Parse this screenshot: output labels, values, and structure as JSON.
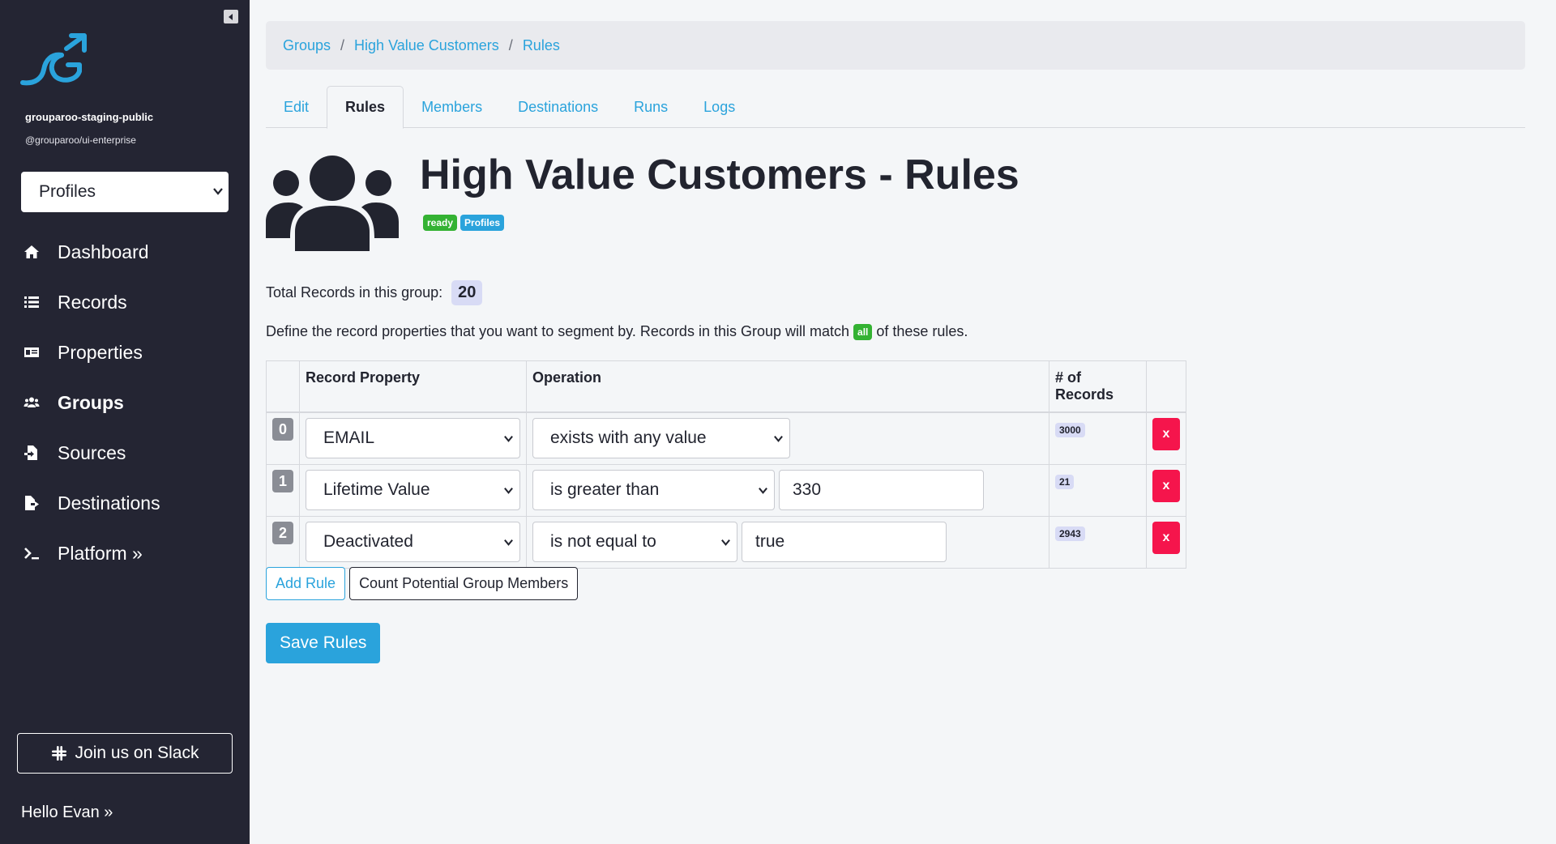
{
  "sidebar": {
    "org_name": "grouparoo-staging-public",
    "org_package": "@grouparoo/ui-enterprise",
    "model_select": "Profiles",
    "nav": [
      {
        "label": "Dashboard",
        "icon": "home-icon"
      },
      {
        "label": "Records",
        "icon": "list-icon"
      },
      {
        "label": "Properties",
        "icon": "id-card-icon"
      },
      {
        "label": "Groups",
        "icon": "users-icon",
        "active": true
      },
      {
        "label": "Sources",
        "icon": "file-import-icon"
      },
      {
        "label": "Destinations",
        "icon": "file-export-icon"
      },
      {
        "label": "Platform »",
        "icon": "terminal-icon"
      }
    ],
    "slack_label": "Join us on Slack",
    "hello": "Hello Evan »"
  },
  "breadcrumb": {
    "items": [
      "Groups",
      "High Value Customers",
      "Rules"
    ],
    "separator": "/"
  },
  "tabs": [
    "Edit",
    "Rules",
    "Members",
    "Destinations",
    "Runs",
    "Logs"
  ],
  "active_tab": "Rules",
  "page": {
    "title": "High Value Customers - Rules",
    "badge_state": "ready",
    "badge_model": "Profiles",
    "total_label": "Total Records in this group:",
    "total_count": "20",
    "define_before": "Define the record properties that you want to segment by. Records in this Group will match",
    "define_match": "all",
    "define_after": "of these rules."
  },
  "table": {
    "headers": [
      "Record Property",
      "Operation",
      "# of Records"
    ],
    "rows": [
      {
        "index": "0",
        "property": "EMAIL",
        "operation": "exists with any value",
        "value": "",
        "count": "3000",
        "delete": "x"
      },
      {
        "index": "1",
        "property": "Lifetime Value",
        "operation": "is greater than",
        "value": "330",
        "count": "21",
        "delete": "x"
      },
      {
        "index": "2",
        "property": "Deactivated",
        "operation": "is not equal to",
        "value": "true",
        "count": "2943",
        "delete": "x"
      }
    ]
  },
  "buttons": {
    "add_rule": "Add Rule",
    "count_members": "Count Potential Group Members",
    "save": "Save Rules"
  },
  "colors": {
    "sidebar_bg": "#242533",
    "accent": "#2aa3dc",
    "success": "#34b233",
    "danger": "#f5154c",
    "count_bg": "#d8dbf5"
  }
}
